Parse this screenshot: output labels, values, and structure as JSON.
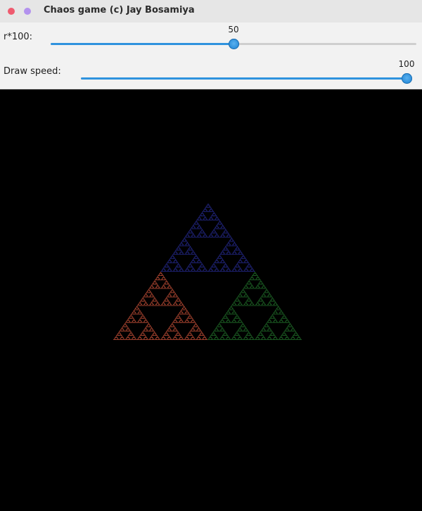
{
  "window": {
    "title": "Chaos game (c) Jay Bosamiya"
  },
  "controls": {
    "ratio": {
      "label": "r*100:",
      "value": 50,
      "min": 0,
      "max": 100
    },
    "speed": {
      "label": "Draw speed:",
      "value": 100,
      "min": 0,
      "max": 100
    }
  },
  "colors": {
    "top_vertex": "#2a2fa0",
    "left_vertex": "#d9583e",
    "right_vertex": "#247a2e",
    "slider_accent": "#2f93de"
  }
}
